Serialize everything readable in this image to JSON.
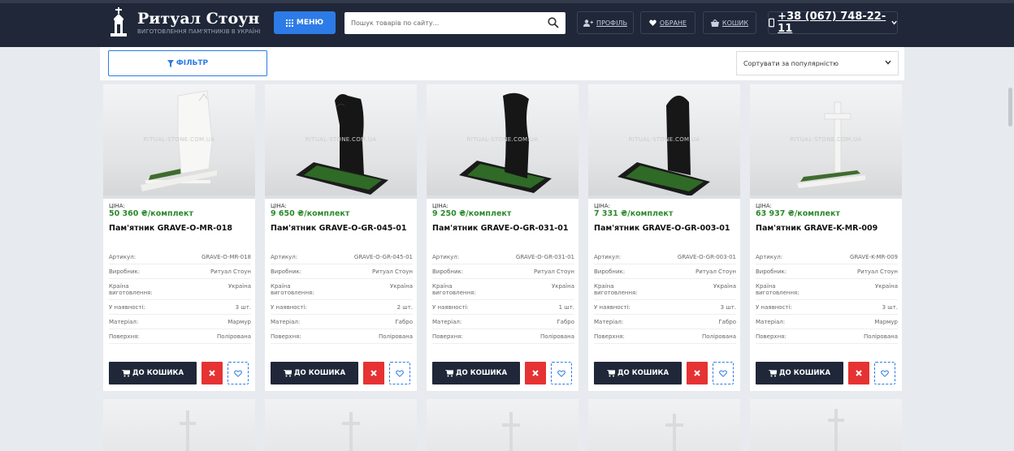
{
  "header": {
    "logo_title": "Ритуал Стоун",
    "logo_subtitle": "ВИГОТОВЛЕННЯ ПАМ'ЯТНИКІВ В УКРАЇНІ",
    "menu_label": "МЕНЮ",
    "search_placeholder": "Пошук товарів по сайту...",
    "profile_label": "ПРОФІЛЬ",
    "favorites_label": "ОБРАНЕ",
    "cart_label": "КОШИК",
    "phone": "+38 (067) 748-22-11"
  },
  "filter": {
    "filter_label": "ФІЛЬТР",
    "sort_label": "Сортувати за популярністю"
  },
  "watermark": "RITUAL-STONE.COM.UA",
  "labels": {
    "price": "ЦІНА:",
    "article": "Артикул:",
    "manufacturer": "Виробник:",
    "country": "Країна виготовлення:",
    "stock": "У наявності:",
    "material": "Матеріал:",
    "surface": "Поверхня:",
    "add_to_cart": "ДО КОШИКА"
  },
  "products": [
    {
      "price": "50 360 ₴/комплект",
      "title": "Пам'ятник GRAVE-O-MR-018",
      "article": "GRAVE-O-MR-018",
      "manufacturer": "Ритуал Стоун",
      "country": "Україна",
      "stock": "3 шт.",
      "material": "Мармур",
      "surface": "Полірована"
    },
    {
      "price": "9 650 ₴/комплект",
      "title": "Пам'ятник GRAVE-O-GR-045-01",
      "article": "GRAVE-O-GR-045-01",
      "manufacturer": "Ритуал Стоун",
      "country": "Україна",
      "stock": "2 шт.",
      "material": "Габро",
      "surface": "Полірована"
    },
    {
      "price": "9 250 ₴/комплект",
      "title": "Пам'ятник GRAVE-O-GR-031-01",
      "article": "GRAVE-O-GR-031-01",
      "manufacturer": "Ритуал Стоун",
      "country": "Україна",
      "stock": "1 шт.",
      "material": "Габро",
      "surface": "Полірована"
    },
    {
      "price": "7 331 ₴/комплект",
      "title": "Пам'ятник GRAVE-O-GR-003-01",
      "article": "GRAVE-O-GR-003-01",
      "manufacturer": "Ритуал Стоун",
      "country": "Україна",
      "stock": "3 шт.",
      "material": "Габро",
      "surface": "Полірована"
    },
    {
      "price": "63 937 ₴/комплект",
      "title": "Пам'ятник GRAVE-K-MR-009",
      "article": "GRAVE-K-MR-009",
      "manufacturer": "Ритуал Стоун",
      "country": "Україна",
      "stock": "3 шт.",
      "material": "Мармур",
      "surface": "Полірована"
    }
  ]
}
